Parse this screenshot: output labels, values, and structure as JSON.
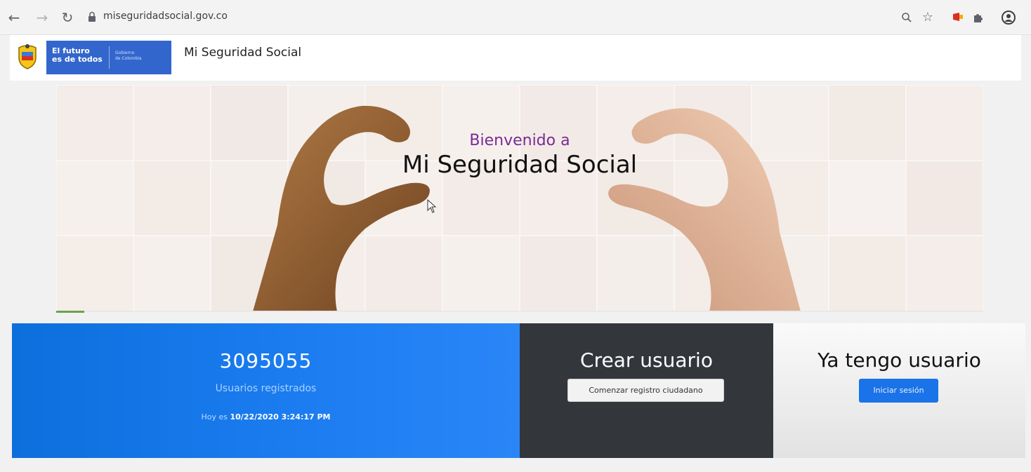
{
  "browser": {
    "url": "miseguridadsocial.gov.co",
    "icons": [
      "back-icon",
      "forward-icon",
      "reload-icon",
      "lock-icon",
      "zoom-icon",
      "star-icon",
      "extension-flag-icon",
      "extensions-puzzle-icon",
      "profile-icon"
    ]
  },
  "header": {
    "logo_line1": "El futuro",
    "logo_line2": "es de todos",
    "logo_sub1": "Gobierno",
    "logo_sub2": "de Colombia",
    "site_title": "Mi Seguridad Social"
  },
  "hero": {
    "kicker": "Bienvenido a",
    "title": "Mi Seguridad Social"
  },
  "stats": {
    "count": "3095055",
    "count_label": "Usuarios registrados",
    "date_prefix": "Hoy es",
    "date_value": "10/22/2020 3:24:17 PM"
  },
  "create": {
    "heading": "Crear usuario",
    "button": "Comenzar registro ciudadano"
  },
  "login": {
    "heading": "Ya tengo usuario",
    "button": "Iniciar sesión"
  },
  "colors": {
    "gov_blue": "#3366cc",
    "stats_blue": "#1b7cf0",
    "dark_panel": "#33363b",
    "primary_button": "#1a73e8",
    "kicker_purple": "#7a2b96"
  }
}
